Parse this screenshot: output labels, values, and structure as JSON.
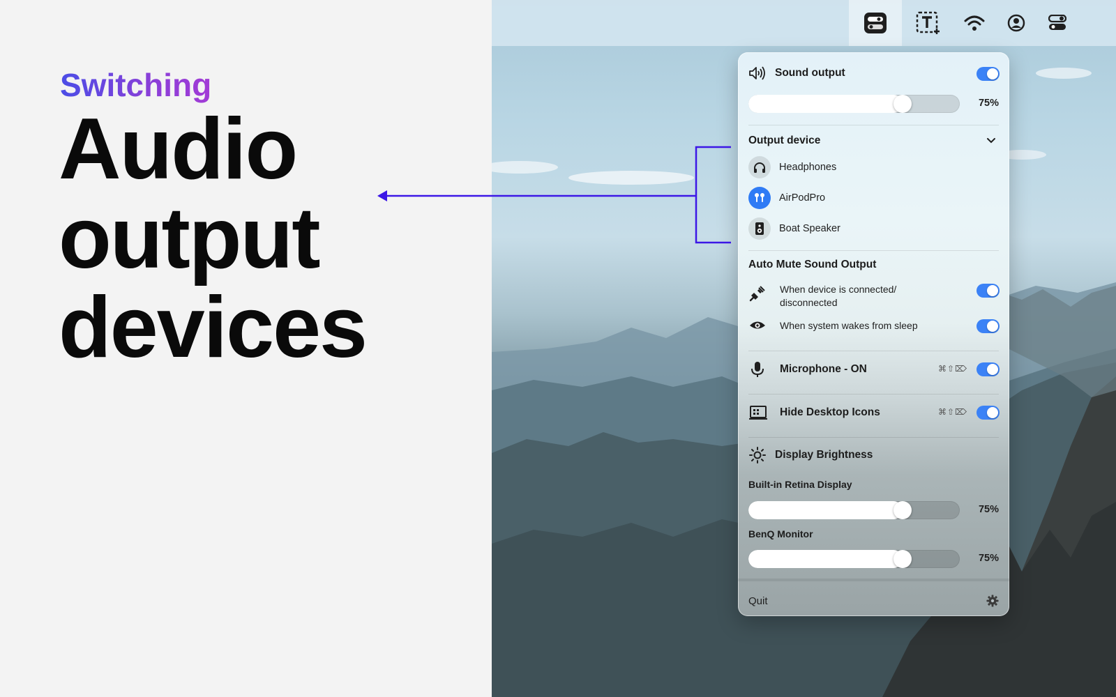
{
  "promo": {
    "eyebrow": "Switching",
    "headline": [
      "Audio",
      "output",
      "devices"
    ]
  },
  "menubar": {
    "icons": [
      "toggle-panel-icon",
      "text-capture-icon",
      "wifi-icon",
      "user-account-icon",
      "control-center-icon"
    ]
  },
  "popover": {
    "sound_output": {
      "title": "Sound output",
      "enabled": true,
      "volume_percent": 75,
      "volume_label": "75%"
    },
    "output_device": {
      "title": "Output device",
      "devices": [
        {
          "name": "Headphones",
          "icon": "headphones-icon",
          "active": false
        },
        {
          "name": "AirPodPro",
          "icon": "airpods-icon",
          "active": true
        },
        {
          "name": "Boat Speaker",
          "icon": "speaker-icon",
          "active": false
        }
      ]
    },
    "auto_mute": {
      "title": "Auto Mute Sound Output",
      "options": [
        {
          "label_line1": "When device is connected/",
          "label_line2": "disconnected",
          "enabled": true
        },
        {
          "label_line1": "When system wakes from sleep",
          "label_line2": "",
          "enabled": true
        }
      ]
    },
    "microphone": {
      "label": "Microphone - ON",
      "shortcut": "⌘⇧⌦",
      "enabled": true
    },
    "hide_icons": {
      "label": "Hide Desktop Icons",
      "shortcut": "⌘⇧⌦",
      "enabled": true
    },
    "brightness": {
      "title": "Display Brightness",
      "displays": [
        {
          "name": "Built-in Retina Display",
          "percent": 75,
          "label": "75%"
        },
        {
          "name": "BenQ Monitor",
          "percent": 75,
          "label": "75%"
        }
      ]
    },
    "footer": {
      "quit_label": "Quit"
    }
  },
  "colors": {
    "accent": "#3b82f6",
    "callout": "#3c17e6",
    "eyebrow_start": "#4a4de6",
    "eyebrow_end": "#a23bd6"
  }
}
